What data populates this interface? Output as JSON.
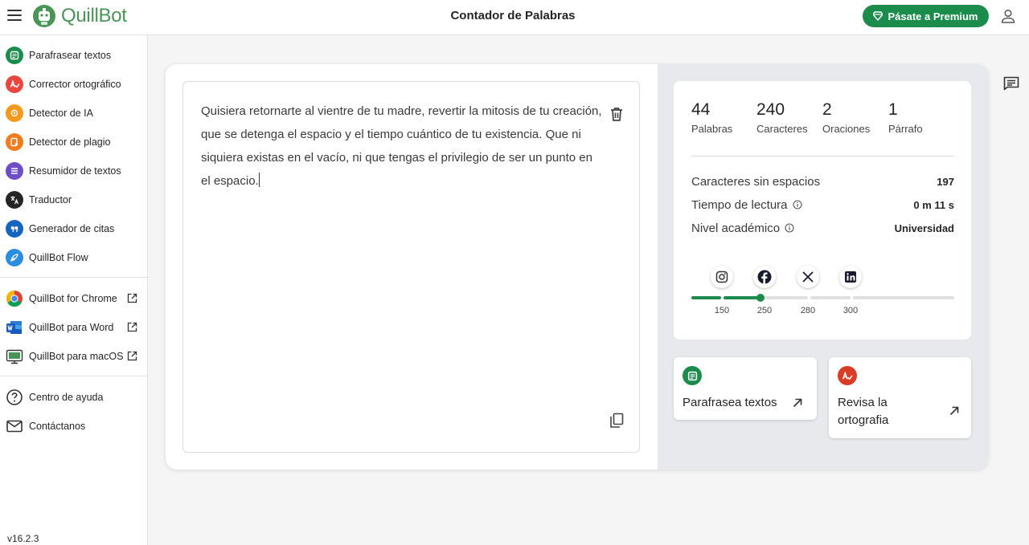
{
  "header": {
    "logo_text": "QuillBot",
    "page_title": "Contador de Palabras",
    "premium_label": "Pásate a Premium"
  },
  "sidebar": {
    "items": [
      {
        "label": "Parafrasear textos",
        "icon": "paraphrase-icon",
        "color": "#1c8c4c"
      },
      {
        "label": "Corrector ortográfico",
        "icon": "grammar-icon",
        "color": "#e8473f"
      },
      {
        "label": "Detector de IA",
        "icon": "ai-detector-icon",
        "color": "#f39a1e"
      },
      {
        "label": "Detector de plagio",
        "icon": "plagiarism-icon",
        "color": "#f07c1e"
      },
      {
        "label": "Resumidor de textos",
        "icon": "summarizer-icon",
        "color": "#6c4fc7"
      },
      {
        "label": "Traductor",
        "icon": "translator-icon",
        "color": "#252525"
      },
      {
        "label": "Generador de citas",
        "icon": "citation-icon",
        "color": "#1565c0"
      },
      {
        "label": "QuillBot Flow",
        "icon": "flow-icon",
        "color": "#2a8de0"
      }
    ],
    "extensions": [
      {
        "label": "QuillBot for Chrome",
        "icon": "chrome-icon"
      },
      {
        "label": "QuillBot para Word",
        "icon": "word-icon"
      },
      {
        "label": "QuillBot para macOS",
        "icon": "macos-icon"
      }
    ],
    "help": [
      {
        "label": "Centro de ayuda",
        "icon": "help-icon"
      },
      {
        "label": "Contáctanos",
        "icon": "mail-icon"
      }
    ],
    "version": "v16.2.3"
  },
  "editor": {
    "text": "Quisiera retornarte al vientre de tu madre, revertir la mitosis de tu creación, que se detenga el espacio y el tiempo cuántico de tu existencia. Que ni siquiera existas en el vacío, ni que tengas el privilegio de ser un punto en el espacio."
  },
  "stats": {
    "counts": [
      {
        "value": "44",
        "label": "Palabras"
      },
      {
        "value": "240",
        "label": "Caracteres"
      },
      {
        "value": "2",
        "label": "Oraciones"
      },
      {
        "value": "1",
        "label": "Párrafo"
      }
    ],
    "rows": [
      {
        "label": "Caracteres sin espacios",
        "value": "197",
        "info": false
      },
      {
        "label": "Tiempo de lectura",
        "value": "0 m 11 s",
        "info": true
      },
      {
        "label": "Nivel académico",
        "value": "Universidad",
        "info": true
      }
    ],
    "social_limits": [
      {
        "network": "instagram-icon",
        "limit": "150"
      },
      {
        "network": "facebook-icon",
        "limit": "250"
      },
      {
        "network": "x-icon",
        "limit": "280"
      },
      {
        "network": "linkedin-icon",
        "limit": "300"
      }
    ],
    "progress_words": 240,
    "accent": "#1c8c4c"
  },
  "actions": [
    {
      "label": "Parafrasea textos",
      "icon": "paraphrase-icon",
      "color": "#1c8c4c"
    },
    {
      "label": "Revisa la ortografia",
      "icon": "grammar-icon",
      "color": "#e8473f"
    }
  ]
}
